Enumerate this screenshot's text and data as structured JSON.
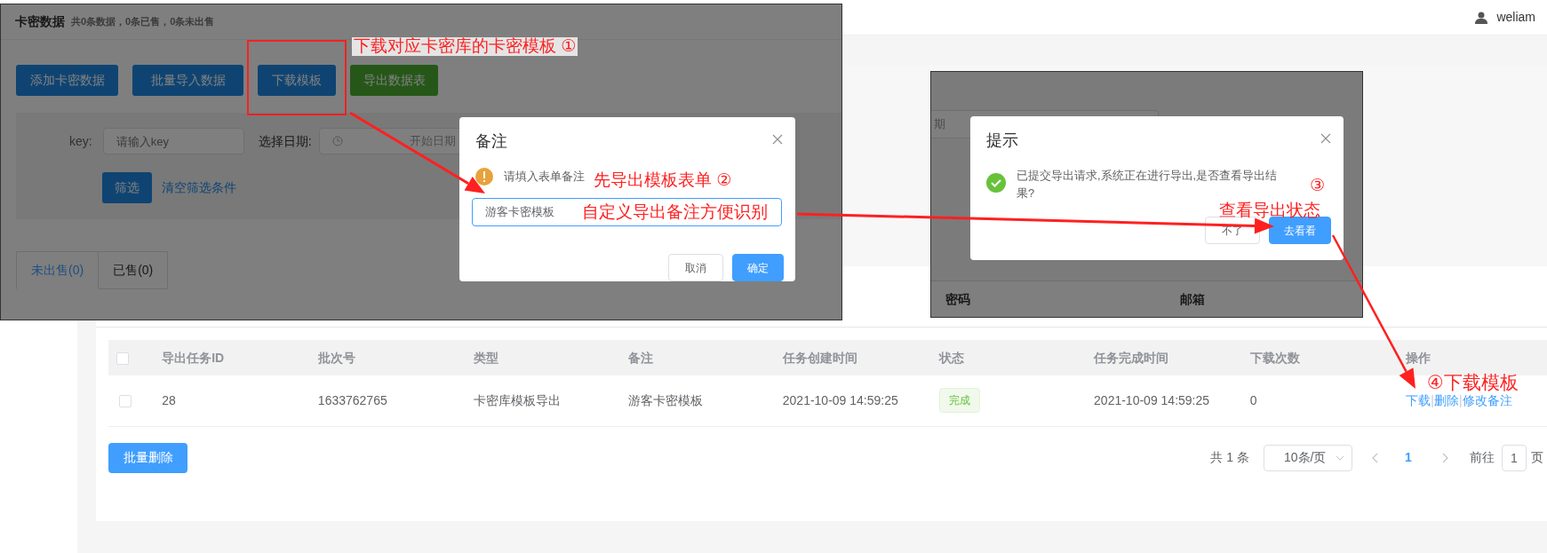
{
  "header": {
    "user": "weliam"
  },
  "export_table": {
    "all_selected": false,
    "columns": [
      "导出任务ID",
      "批次号",
      "类型",
      "备注",
      "任务创建时间",
      "状态",
      "任务完成时间",
      "下载次数",
      "操作"
    ],
    "rows": [
      {
        "selected": false,
        "cells": [
          "28",
          "1633762765",
          "卡密库模板导出",
          "游客卡密模板",
          "2021-10-09 14:59:25"
        ],
        "status": "完成",
        "finished": "2021-10-09 14:59:25",
        "downloads": "0",
        "actions": [
          {
            "text": "下载",
            "kind": "link"
          },
          {
            "text": "|",
            "kind": "separator"
          },
          {
            "text": "删除",
            "kind": "link"
          },
          {
            "text": "|",
            "kind": "separator"
          },
          {
            "text": "修改备注",
            "kind": "link"
          }
        ]
      }
    ]
  },
  "batch_delete": "批量删除",
  "pagination": {
    "total": "共 1 条",
    "page_size": "10条/页",
    "pages": [
      {
        "label": "1",
        "selected": true
      }
    ],
    "goto_label": "前往",
    "goto_value": "1",
    "goto_suffix": "页"
  },
  "screenshot_1": {
    "title": "卡密数据",
    "summary": "共0条数据，0条已售，0条未出售",
    "buttons": [
      {
        "label": "添加卡密数据",
        "kind": "primary"
      },
      {
        "label": "批量导入数据",
        "kind": "primary"
      },
      {
        "label": "下载模板",
        "kind": "primary"
      },
      {
        "label": "导出数据表",
        "kind": "success"
      }
    ],
    "filter": {
      "key_label": "key:",
      "key_placeholder": "请输入key",
      "date_label": "选择日期:",
      "date_placeholder": "开始日期",
      "filter_button": "筛选",
      "clear_link": "清空筛选条件"
    },
    "tabs": [
      {
        "label": "未出售(0)",
        "selected": true
      },
      {
        "label": "已售(0)",
        "selected": false
      }
    ],
    "dialog": {
      "title": "备注",
      "message": "请填入表单备注",
      "input_value": "游客卡密模板",
      "buttons": [
        "取消",
        "确定"
      ]
    }
  },
  "screenshot_2": {
    "date_placeholder": "期",
    "columns": [
      "密码",
      "邮箱"
    ],
    "dialog": {
      "title": "提示",
      "message": "已提交导出请求,系统正在进行导出,是否查看导出结果?",
      "buttons": [
        "不了",
        "去看看"
      ]
    }
  },
  "annotations": [
    {
      "text": "下载对应卡密库的卡密模板 ①"
    },
    {
      "text": "先导出模板表单 ②"
    },
    {
      "text": "自定义导出备注方便识别"
    },
    {
      "text": "③"
    },
    {
      "text": "查看导出状态"
    },
    {
      "text": "④下载模板"
    }
  ]
}
